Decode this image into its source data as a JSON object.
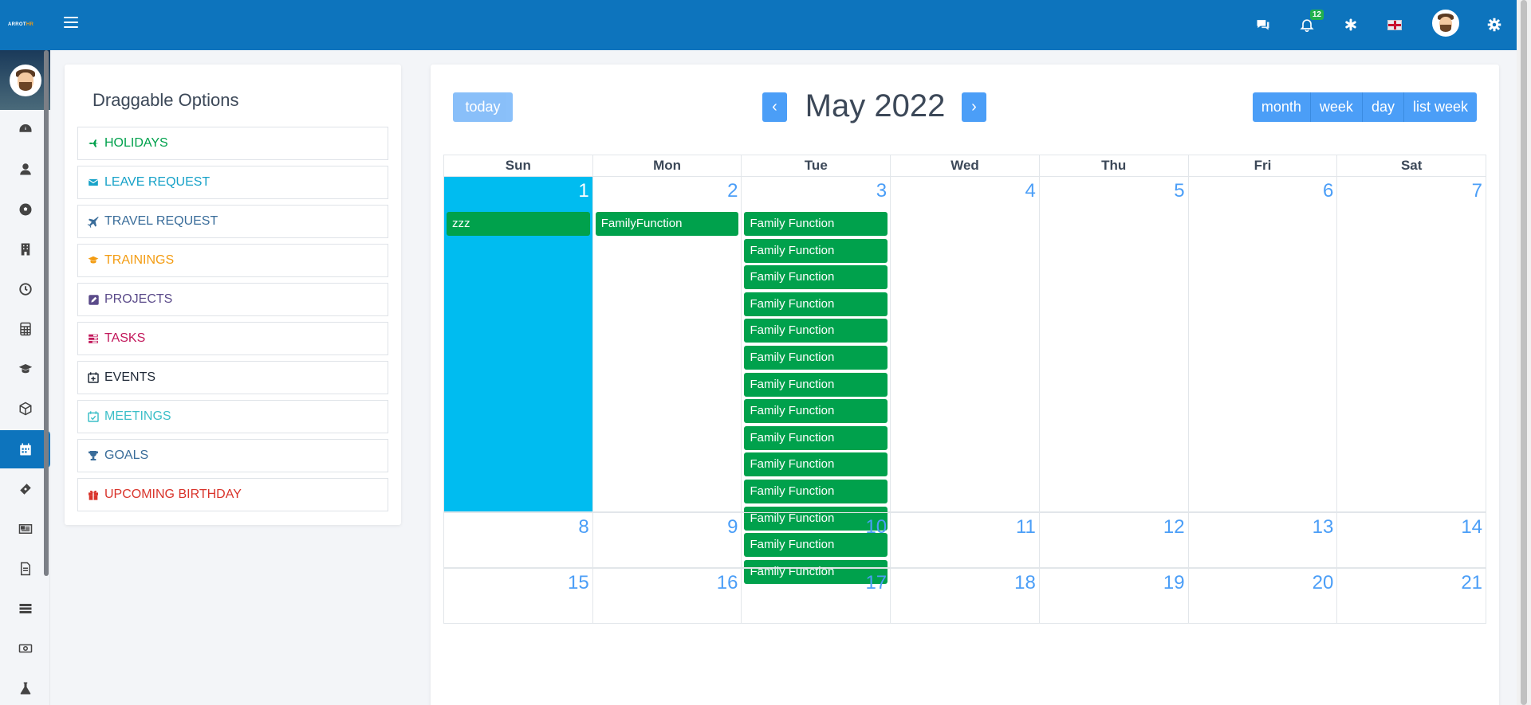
{
  "topbar": {
    "logo_text": "ARROT",
    "logo_suffix": "HR",
    "notification_count": "12",
    "icons": [
      "chat-icon",
      "bell-icon",
      "asterisk-icon",
      "flag-icon",
      "user-avatar",
      "gear-icon"
    ]
  },
  "sidebar": {
    "items": [
      "dashboard-icon",
      "user-icon",
      "soccer-icon",
      "building-icon",
      "clock-icon",
      "calculator-icon",
      "graduation-cap-icon",
      "box-icon",
      "calendar-icon",
      "ticket-icon",
      "newspaper-icon",
      "document-icon",
      "list-icon",
      "money-icon",
      "flask-icon"
    ],
    "active_index": 8
  },
  "draggable": {
    "title": "Draggable Options",
    "items": [
      {
        "label": "HOLIDAYS",
        "color": "#00a14c",
        "icon": "plane-icon"
      },
      {
        "label": "LEAVE REQUEST",
        "color": "#17a2c8",
        "icon": "envelope-icon"
      },
      {
        "label": "TRAVEL REQUEST",
        "color": "#3a6d9a",
        "icon": "plane-icon"
      },
      {
        "label": "TRAININGS",
        "color": "#f39c12",
        "icon": "graduation-cap-icon"
      },
      {
        "label": "PROJECTS",
        "color": "#5b4b8a",
        "icon": "edit-icon"
      },
      {
        "label": "TASKS",
        "color": "#c2185b",
        "icon": "tasks-icon"
      },
      {
        "label": "EVENTS",
        "color": "#1f2937",
        "icon": "calendar-plus-icon"
      },
      {
        "label": "MEETINGS",
        "color": "#3cbfc8",
        "icon": "calendar-check-icon"
      },
      {
        "label": "GOALS",
        "color": "#3a6d9a",
        "icon": "trophy-icon"
      },
      {
        "label": "UPCOMING BIRTHDAY",
        "color": "#d9342b",
        "icon": "gift-icon"
      }
    ]
  },
  "calendar": {
    "today_label": "today",
    "prev_label": "‹",
    "next_label": "›",
    "title": "May 2022",
    "views": [
      "month",
      "week",
      "day",
      "list week"
    ],
    "days_of_week": [
      "Sun",
      "Mon",
      "Tue",
      "Wed",
      "Thu",
      "Fri",
      "Sat"
    ],
    "weeks": [
      [
        {
          "day": "1",
          "today": true,
          "events": [
            "zzz"
          ]
        },
        {
          "day": "2",
          "events": [
            "FamilyFunction"
          ]
        },
        {
          "day": "3",
          "events": [
            "Family Function",
            "Family Function",
            "Family Function",
            "Family Function",
            "Family Function",
            "Family Function",
            "Family Function",
            "Family Function",
            "Family Function",
            "Family Function",
            "Family Function",
            "Family Function",
            "Family Function",
            "Family Function"
          ]
        },
        {
          "day": "4",
          "events": []
        },
        {
          "day": "5",
          "events": []
        },
        {
          "day": "6",
          "events": []
        },
        {
          "day": "7",
          "events": []
        }
      ],
      [
        {
          "day": "8",
          "events": []
        },
        {
          "day": "9",
          "events": []
        },
        {
          "day": "10",
          "events": []
        },
        {
          "day": "11",
          "events": []
        },
        {
          "day": "12",
          "events": []
        },
        {
          "day": "13",
          "events": []
        },
        {
          "day": "14",
          "events": []
        }
      ],
      [
        {
          "day": "15",
          "events": []
        },
        {
          "day": "16",
          "events": []
        },
        {
          "day": "17",
          "events": []
        },
        {
          "day": "18",
          "events": []
        },
        {
          "day": "19",
          "events": []
        },
        {
          "day": "20",
          "events": []
        },
        {
          "day": "21",
          "events": []
        }
      ]
    ]
  }
}
